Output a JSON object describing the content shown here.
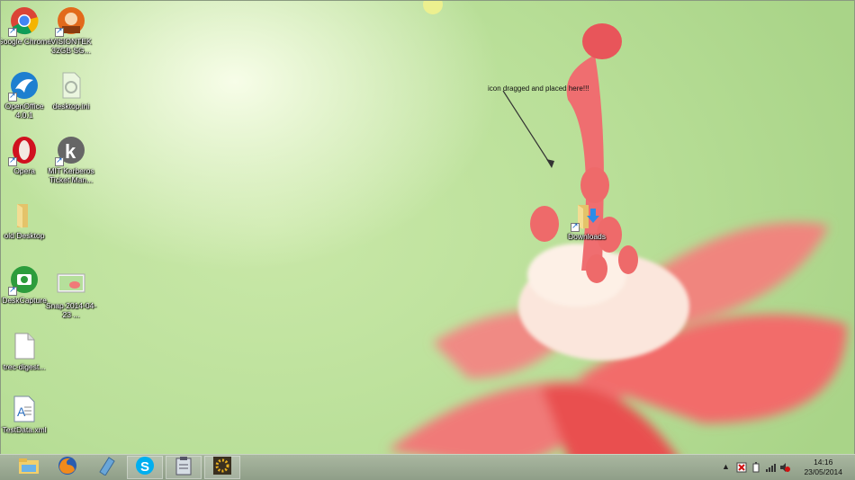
{
  "annotation": "icon dragged and placed here!!!",
  "desktop_icons": [
    {
      "label": "Google Chrome",
      "icon": "chrome-icon"
    },
    {
      "label": "VISIONTEK 32GB SG...",
      "icon": "visiontek-icon"
    },
    {
      "label": "OpenOffice 4.0.1",
      "icon": "openoffice-icon"
    },
    {
      "label": "desktop.ini",
      "icon": "ini-file-icon"
    },
    {
      "label": "Opera",
      "icon": "opera-icon"
    },
    {
      "label": "MIT Kerberos Ticket Man...",
      "icon": "kerberos-icon"
    },
    {
      "label": "old Desktop",
      "icon": "folder-icon"
    },
    {
      "label": "DeskCapture",
      "icon": "deskcapture-icon"
    },
    {
      "label": "Snap 2014-04-23 ...",
      "icon": "image-file-icon"
    },
    {
      "label": "trec-digest...",
      "icon": "document-icon"
    },
    {
      "label": "TestData.xml",
      "icon": "xml-file-icon"
    },
    {
      "label": "Downloads",
      "icon": "downloads-folder-icon"
    }
  ],
  "taskbar": {
    "apps": [
      "file-explorer-icon",
      "firefox-icon",
      "notepad-icon",
      "skype-icon",
      "clipboard-app-icon",
      "jatoolkit-icon"
    ],
    "tray_icons": [
      "show-hidden-icons-icon",
      "action-center-icon",
      "power-icon",
      "network-signal-icon",
      "volume-muted-icon"
    ],
    "time": "14:16",
    "date": "23/05/2014"
  }
}
